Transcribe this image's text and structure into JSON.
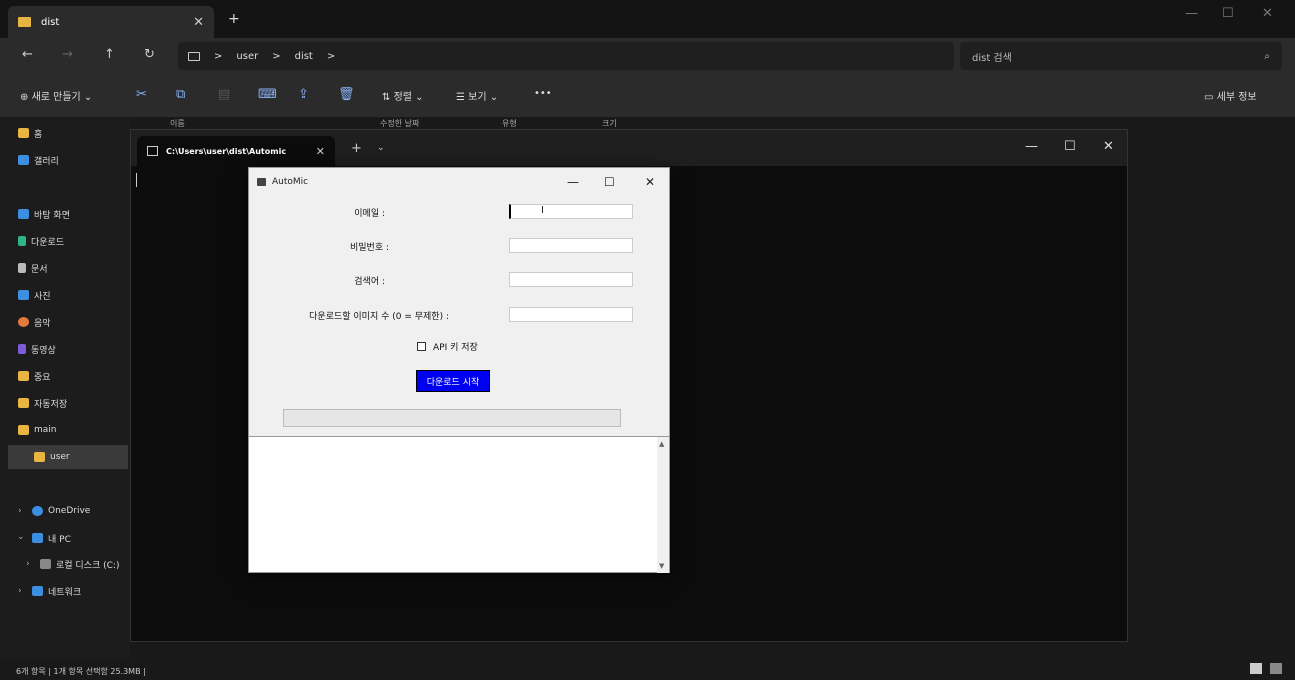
{
  "explorer": {
    "tab_title": "dist",
    "tab_close": "✕",
    "new_tab": "+",
    "window_controls": {
      "minimize": "—",
      "maximize": "☐",
      "close": "✕"
    },
    "nav": {
      "back": "←",
      "forward": "→",
      "up": "↑",
      "refresh": "↻"
    },
    "breadcrumb": [
      "user",
      "dist"
    ],
    "breadcrumb_sep": ">",
    "search_placeholder": "dist 검색",
    "commands": {
      "new": "새로 만들기",
      "sort": "정렬",
      "view": "보기",
      "more": "•••",
      "details": "세부 정보"
    },
    "columns": [
      "이름",
      "수정한 날짜",
      "유형",
      "크기"
    ],
    "sidebar": {
      "home": "홈",
      "gallery": "갤러리",
      "desktop": "바탕 화면",
      "downloads": "다운로드",
      "documents": "문서",
      "pictures": "사진",
      "music": "음악",
      "videos": "동영상",
      "folder1": "중요",
      "folder2": "자동저장",
      "folder3": "main",
      "folder4": "user",
      "onedrive": "OneDrive",
      "thispc": "내 PC",
      "localdisk": "로컬 디스크 (C:)",
      "network": "네트워크"
    },
    "status": "6개 항목  |  1개 항목 선택함 25.3MB  |"
  },
  "terminal": {
    "tab_title": "C:\\Users\\user\\dist\\Automic",
    "close": "✕",
    "plus": "+",
    "caret": "⌄",
    "window_controls": {
      "minimize": "—",
      "maximize": "☐",
      "close": "✕"
    }
  },
  "dialog": {
    "title": "AutoMic",
    "window_controls": {
      "minimize": "—",
      "maximize": "☐",
      "close": "✕"
    },
    "labels": {
      "email": "이메일 :",
      "password": "비밀번호 :",
      "keyword": "검색어 :",
      "count": "다운로드할 이미지 수 (0 = 무제한) :"
    },
    "checkbox_label": "API 키 저장",
    "start_button": "다운로드 시작",
    "progress": 0,
    "scroll_up": "▲",
    "scroll_down": "▼"
  }
}
